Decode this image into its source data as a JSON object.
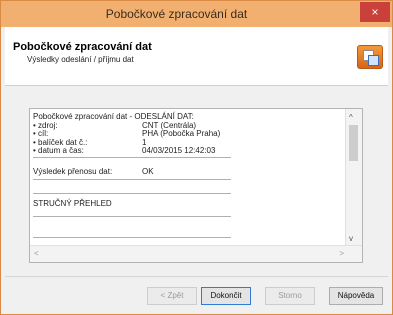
{
  "window": {
    "title": "Pobočkové zpracování dat",
    "close_glyph": "×"
  },
  "header": {
    "title": "Pobočkové zpracování dat",
    "subtitle": "Výsledky odeslání / příjmu dat",
    "icon": "data-transfer-icon"
  },
  "report": {
    "heading": "Pobočkové zpracování dat - ODESLÁNÍ DAT:",
    "rows": [
      {
        "label": "• zdroj:",
        "value": "CNT (Centrála)"
      },
      {
        "label": "• cíl:",
        "value": "PHA (Pobočka Praha)"
      },
      {
        "label": "• balíček dat č.:",
        "value": "1"
      },
      {
        "label": "• datum a čas:",
        "value": "04/03/2015 12:42:03"
      }
    ],
    "result_label": "Výsledek přenosu dat:",
    "result_value": "OK",
    "summary_heading": "STRUČNÝ PŘEHLED"
  },
  "buttons": {
    "back": "< Zpět",
    "finish": "Dokončit",
    "cancel": "Storno",
    "help": "Nápověda"
  },
  "colors": {
    "titlebar": "#f2b070",
    "close": "#c9413a"
  }
}
